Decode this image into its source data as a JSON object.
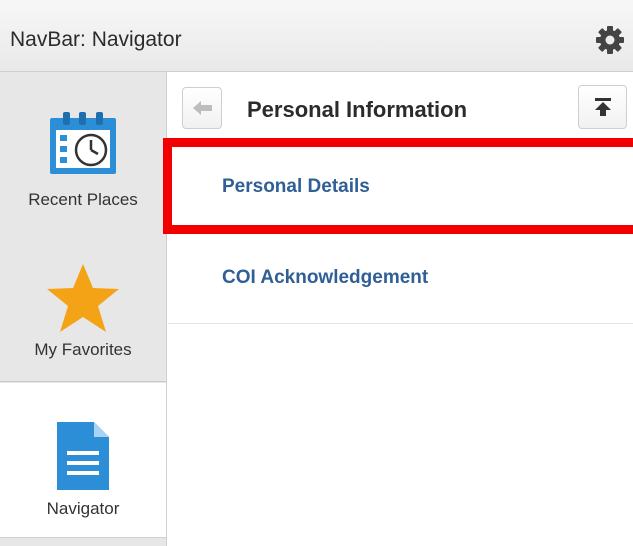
{
  "navbar": {
    "title": "NavBar: Navigator",
    "settings_icon": "gear-icon"
  },
  "sidebar": {
    "items": [
      {
        "label": "Recent Places",
        "icon": "calendar-clock-icon"
      },
      {
        "label": "My Favorites",
        "icon": "star-icon",
        "icon_color": "#f5a316"
      },
      {
        "label": "Navigator",
        "icon": "document-icon",
        "icon_color": "#2b8ed6",
        "selected": true
      }
    ]
  },
  "content": {
    "title": "Personal Information",
    "back_icon": "back-arrow-icon",
    "top_icon": "scroll-to-top-icon",
    "items": [
      {
        "label": "Personal Details",
        "highlighted": true
      },
      {
        "label": "COI Acknowledgement"
      }
    ]
  },
  "colors": {
    "link": "#2f5f95",
    "highlight": "#f20000"
  }
}
